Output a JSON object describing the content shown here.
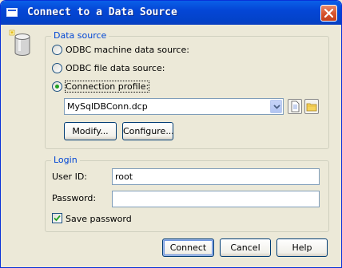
{
  "window": {
    "title": "Connect to a Data Source",
    "close_icon": "close-icon"
  },
  "data_source": {
    "group_title": "Data source",
    "options": [
      {
        "label": "ODBC machine data source:",
        "selected": false
      },
      {
        "label": "ODBC file data source:",
        "selected": false
      },
      {
        "label": "Connection profile:",
        "selected": true
      }
    ],
    "profile_value": "MySqlDBConn.dcp",
    "modify_label": "Modify...",
    "configure_label": "Configure..."
  },
  "login": {
    "group_title": "Login",
    "user_id_label": "User ID:",
    "user_id_value": "root",
    "password_label": "Password:",
    "password_value": "",
    "save_password_label": "Save password",
    "save_password_checked": true
  },
  "buttons": {
    "connect": "Connect",
    "cancel": "Cancel",
    "help": "Help"
  },
  "colors": {
    "titlebar": "#0446d6",
    "group_title": "#0046d5",
    "face": "#ece9d8"
  }
}
